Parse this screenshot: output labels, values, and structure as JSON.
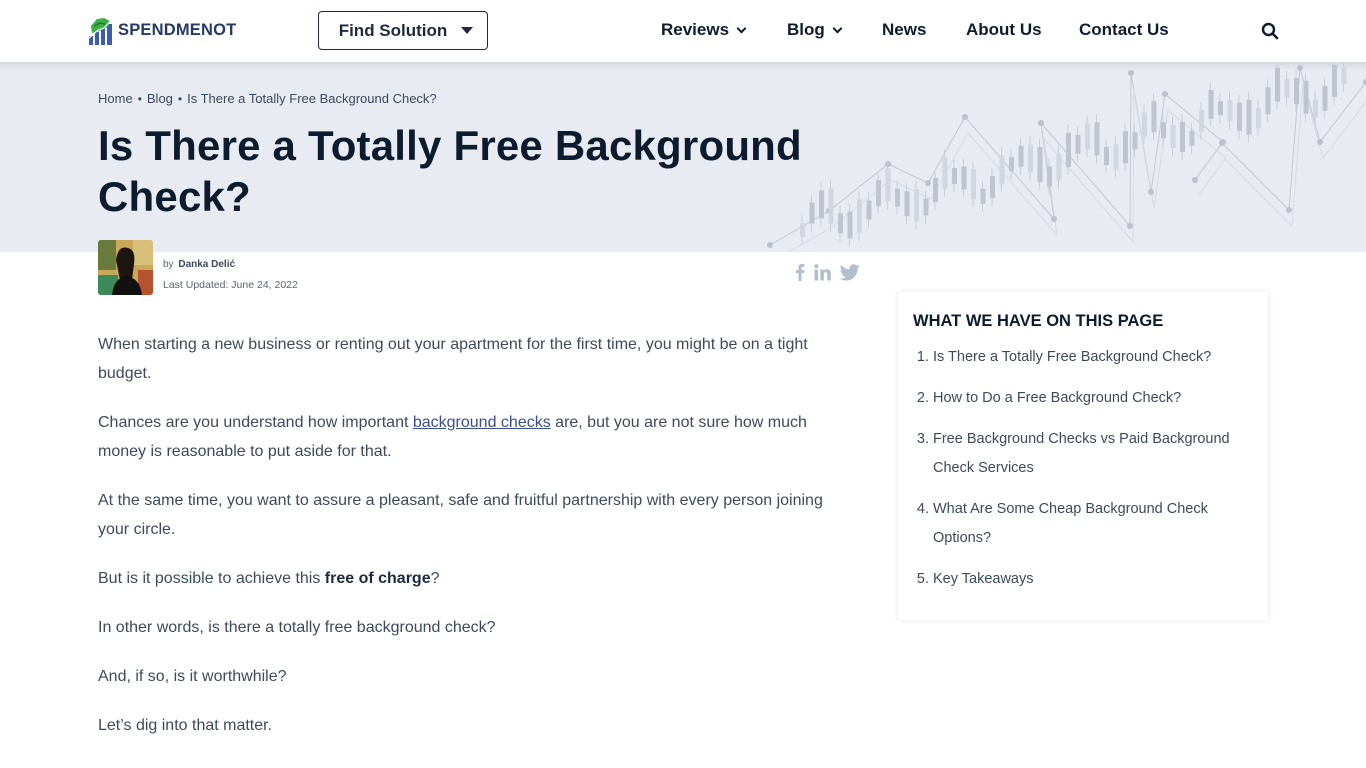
{
  "header": {
    "logo_text": "SPENDMENOT",
    "find_solution_label": "Find Solution",
    "nav": [
      {
        "label": "Reviews",
        "has_dropdown": true
      },
      {
        "label": "Blog",
        "has_dropdown": true
      },
      {
        "label": "News",
        "has_dropdown": false
      },
      {
        "label": "About Us",
        "has_dropdown": false
      },
      {
        "label": "Contact Us",
        "has_dropdown": false
      }
    ],
    "search_icon": "search-icon"
  },
  "breadcrumb": {
    "items": [
      "Home",
      "Blog",
      "Is There a Totally Free Background Check?"
    ],
    "separator": "•"
  },
  "page_title": "Is There a Totally Free Background Check?",
  "author": {
    "by_label": "by",
    "name": "Danka Delić",
    "updated": "Last Updated: June 24, 2022"
  },
  "share": {
    "icons": [
      "facebook-icon",
      "linkedin-icon",
      "twitter-icon"
    ],
    "color": "#b4bfce"
  },
  "article": {
    "p1": "When starting a new business or renting out your apartment for the first time, you might be on a tight budget.",
    "p2_before": "Chances are you understand how important ",
    "p2_link": "background checks",
    "p2_after": " are, but you are not sure how much money is reasonable to put aside for that.",
    "p3": "At the same time, you want to assure a pleasant, safe and fruitful partnership with every person joining your circle.",
    "p4_before": "But is it possible to achieve this ",
    "p4_bold": "free of charge",
    "p4_after": "?",
    "p5": "In other words, is there a totally free background check?",
    "p6": "And, if so, is it worthwhile?",
    "p7": "Let’s dig into that matter."
  },
  "toc": {
    "title": "WHAT WE HAVE ON THIS PAGE",
    "items": [
      {
        "num": "1.",
        "label": "Is There a Totally Free Background Check?"
      },
      {
        "num": "2.",
        "label": "How to Do a Free Background Check?"
      },
      {
        "num": "3.",
        "label": "Free Background Checks vs Paid Background Check Services"
      },
      {
        "num": "4.",
        "label": "What Are Some Cheap Background Check Options?"
      },
      {
        "num": "5.",
        "label": "Key Takeaways"
      }
    ]
  },
  "colors": {
    "brand_navy": "#263a66",
    "heading": "#0d1b2e",
    "body_text": "#3d4a5c",
    "hero_bg": "#e8ebf2",
    "link": "#3a4f8a"
  }
}
